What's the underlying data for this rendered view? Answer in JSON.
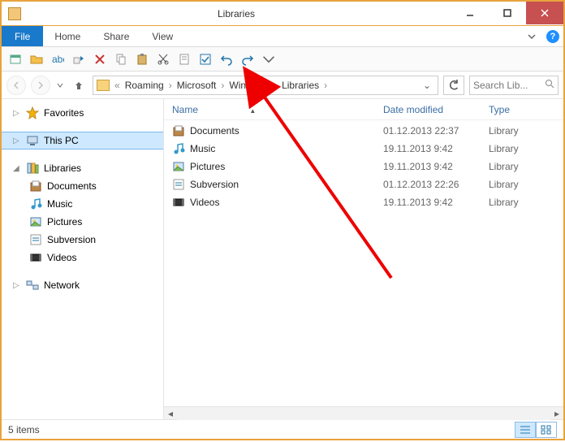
{
  "window": {
    "title": "Libraries"
  },
  "ribbon": {
    "file": "File",
    "tabs": [
      "Home",
      "Share",
      "View"
    ]
  },
  "breadcrumb": {
    "segments": [
      "Roaming",
      "Microsoft",
      "Windows",
      "Libraries"
    ]
  },
  "search": {
    "placeholder": "Search Lib..."
  },
  "sidebar": {
    "favorites": "Favorites",
    "thispc": "This PC",
    "libraries": "Libraries",
    "lib_items": [
      "Documents",
      "Music",
      "Pictures",
      "Subversion",
      "Videos"
    ],
    "network": "Network"
  },
  "columns": {
    "name": "Name",
    "date": "Date modified",
    "type": "Type"
  },
  "rows": [
    {
      "name": "Documents",
      "date": "01.12.2013 22:37",
      "type": "Library",
      "icon": "documents"
    },
    {
      "name": "Music",
      "date": "19.11.2013 9:42",
      "type": "Library",
      "icon": "music"
    },
    {
      "name": "Pictures",
      "date": "19.11.2013 9:42",
      "type": "Library",
      "icon": "pictures"
    },
    {
      "name": "Subversion",
      "date": "01.12.2013 22:26",
      "type": "Library",
      "icon": "subversion"
    },
    {
      "name": "Videos",
      "date": "19.11.2013 9:42",
      "type": "Library",
      "icon": "videos"
    }
  ],
  "status": {
    "count": "5 items"
  }
}
